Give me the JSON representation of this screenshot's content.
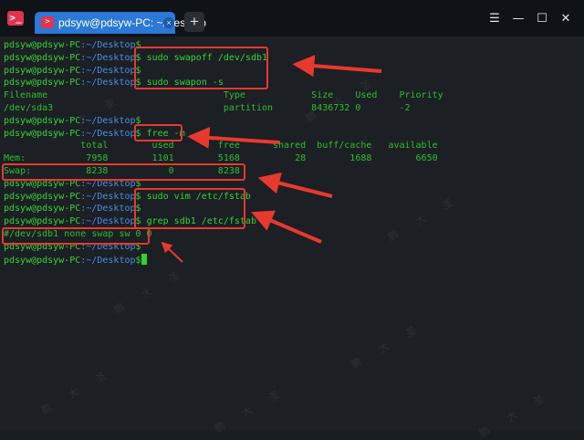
{
  "window": {
    "tab_title": "pdsyw@pdsyw-PC: ~/Desktop",
    "tab_close": "×",
    "add_tab": "+",
    "btn_menu": "☰",
    "btn_min": "—",
    "btn_max": "☐",
    "btn_close": "✕"
  },
  "prompt": {
    "user": "pdsyw@pdsyw-PC",
    "path": ":~/Desktop",
    "dollar": "$"
  },
  "lines": [
    {
      "kind": "prompt",
      "cmd": ""
    },
    {
      "kind": "prompt",
      "cmd": " sudo swapoff /dev/sdb1"
    },
    {
      "kind": "prompt",
      "cmd": ""
    },
    {
      "kind": "prompt",
      "cmd": " sudo swapon -s"
    },
    {
      "kind": "out",
      "text": "Filename                                Type            Size    Used    Priority"
    },
    {
      "kind": "out",
      "text": "/dev/sda3                               partition       8436732 0       -2"
    },
    {
      "kind": "prompt",
      "cmd": ""
    },
    {
      "kind": "prompt",
      "cmd": " free -m"
    },
    {
      "kind": "out",
      "text": "              total        used        free      shared  buff/cache   available"
    },
    {
      "kind": "out",
      "text": "Mem:           7958        1101        5168          28        1688        6650"
    },
    {
      "kind": "out",
      "text": "Swap:          8238           0        8238"
    },
    {
      "kind": "prompt",
      "cmd": ""
    },
    {
      "kind": "prompt",
      "cmd": " sudo vim /etc/fstab"
    },
    {
      "kind": "prompt",
      "cmd": ""
    },
    {
      "kind": "prompt",
      "cmd": " grep sdb1 /etc/fstab"
    },
    {
      "kind": "out",
      "text": "#/dev/sdb1 none swap sw 0 0"
    },
    {
      "kind": "prompt",
      "cmd": ""
    },
    {
      "kind": "prompt",
      "cmd": "",
      "cursor": true
    }
  ],
  "watermark": "鹏 大 圣",
  "colors": {
    "accent_tab": "#2b78d6",
    "prompt_green": "#35d435",
    "path_blue": "#4a8ee8",
    "annotation_red": "#e8392e"
  }
}
